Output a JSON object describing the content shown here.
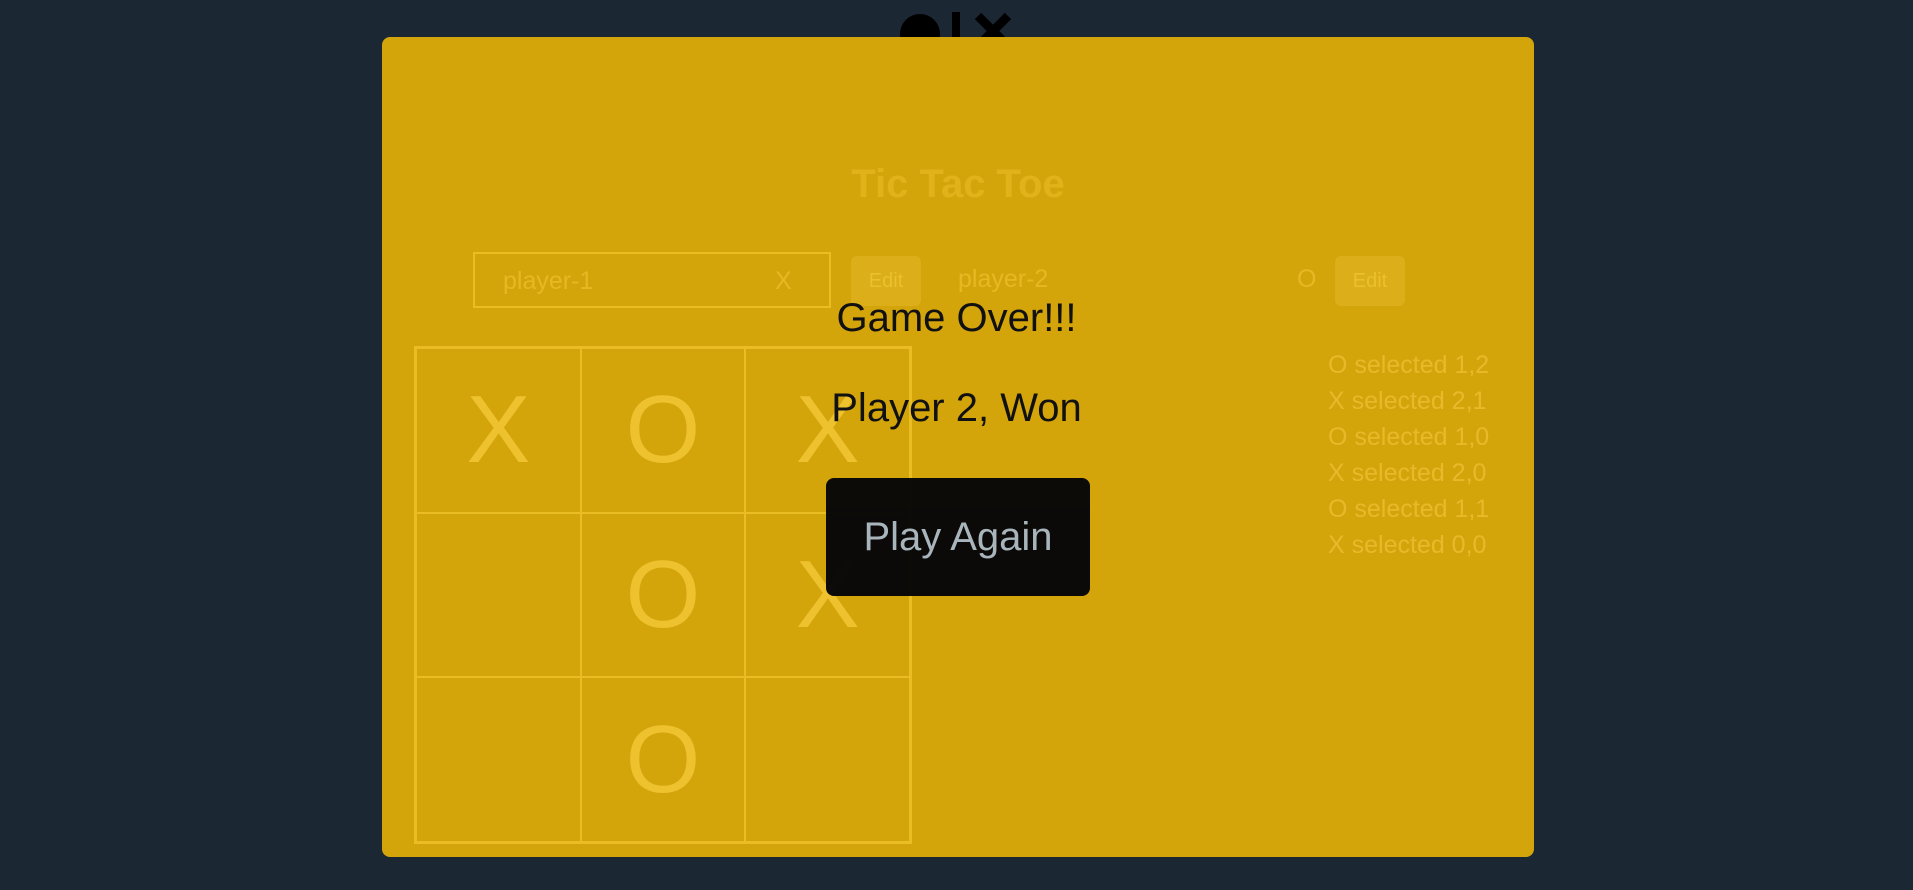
{
  "app": {
    "title": "Tic Tac Toe"
  },
  "players": [
    {
      "name": "player-1",
      "symbol": "X",
      "edit_label": "Edit"
    },
    {
      "name": "player-2",
      "symbol": "O",
      "edit_label": "Edit"
    }
  ],
  "board": {
    "cells": [
      [
        "X",
        "O",
        "X"
      ],
      [
        "",
        "O",
        "X"
      ],
      [
        "",
        "O",
        ""
      ]
    ]
  },
  "log": [
    "O selected 1,2",
    "X selected 2,1",
    "O selected 1,0",
    "X selected 2,0",
    "O selected 1,1",
    "X selected 0,0"
  ],
  "game_over": {
    "title": "Game Over!!!",
    "message": "Player 2, Won",
    "play_again_label": "Play Again"
  },
  "colors": {
    "background": "#1b2733",
    "panel": "#d3a50b",
    "button_dark": "#050608"
  }
}
